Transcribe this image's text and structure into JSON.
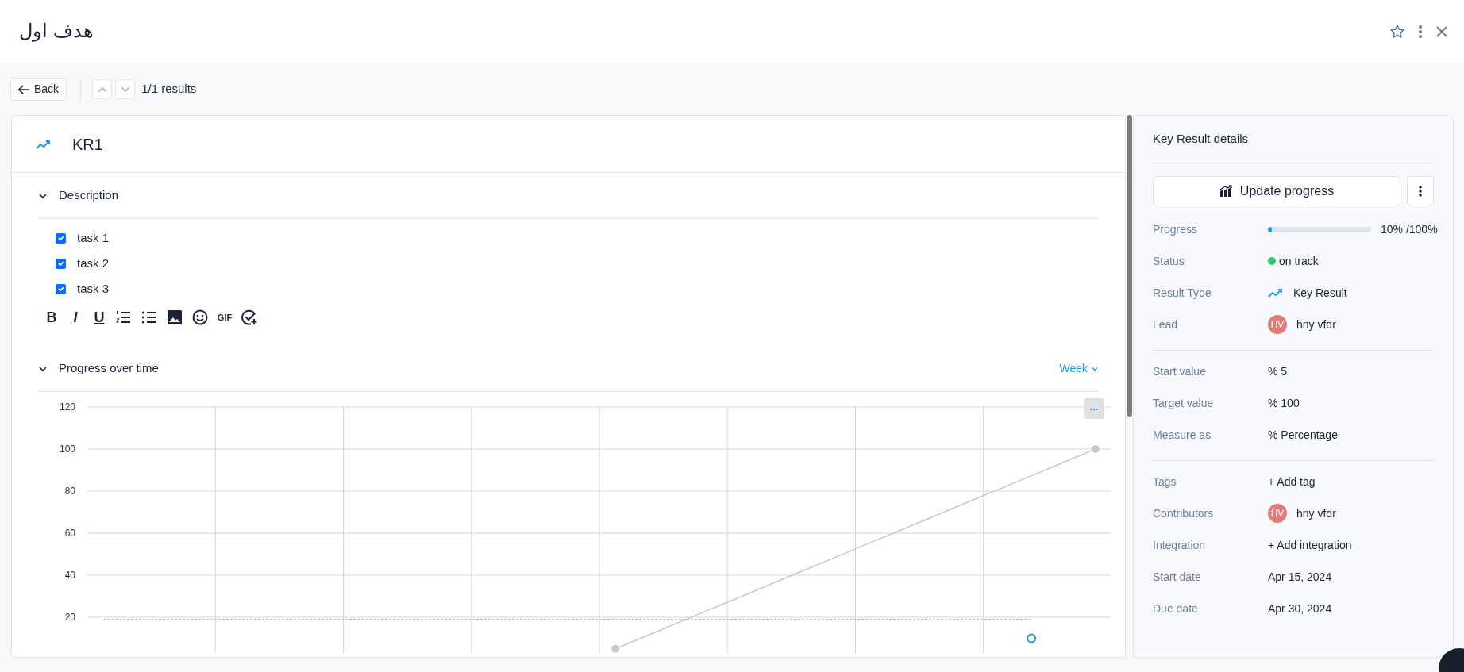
{
  "window": {
    "title": "هدف اول"
  },
  "nav": {
    "back": "Back",
    "results": "1/1 results"
  },
  "key_result": {
    "title": "KR1"
  },
  "description": {
    "heading": "Description",
    "expanded": true,
    "tasks": [
      {
        "text": "task 1",
        "checked": true
      },
      {
        "text": "task 2",
        "checked": true
      },
      {
        "text": "task 3",
        "checked": true
      }
    ],
    "editor_tools": [
      {
        "kind": "bold",
        "label": "B"
      },
      {
        "kind": "italic",
        "label": "I"
      },
      {
        "kind": "underline",
        "label": "U"
      },
      {
        "kind": "ordered-list"
      },
      {
        "kind": "bullet-list"
      },
      {
        "kind": "image"
      },
      {
        "kind": "emoji"
      },
      {
        "kind": "gif",
        "label": "GIF"
      },
      {
        "kind": "task"
      }
    ]
  },
  "progress_chart": {
    "heading": "Progress over time",
    "expanded": true,
    "period": "Week",
    "menu": "...",
    "chart_data": {
      "type": "line",
      "ylim": [
        3,
        120
      ],
      "yticks": [
        20,
        40,
        60,
        80,
        100,
        120
      ],
      "categories": [
        null,
        null,
        null,
        null,
        null,
        null,
        null,
        null,
        null,
        null,
        null,
        null,
        null,
        null,
        null,
        null,
        null,
        null,
        null,
        null,
        null,
        null,
        null,
        null,
        null,
        null,
        null,
        null,
        null,
        null,
        null,
        null
      ],
      "series": [
        {
          "color": "#c8c8cd",
          "values": [
            null,
            null,
            null,
            null,
            null,
            null,
            null,
            null,
            null,
            null,
            null,
            null,
            null,
            null,
            null,
            null,
            5,
            11.3,
            17.7,
            24,
            30.3,
            36.7,
            43,
            49.3,
            55.7,
            62,
            68.3,
            74.7,
            81,
            87.3,
            93.7,
            100
          ]
        },
        {
          "color": "#1a9be6",
          "marker": "hollow-circle",
          "values": [
            null,
            null,
            null,
            null,
            null,
            null,
            null,
            null,
            null,
            null,
            null,
            null,
            null,
            null,
            null,
            null,
            null,
            null,
            null,
            null,
            null,
            null,
            null,
            null,
            null,
            null,
            null,
            null,
            null,
            10,
            null,
            null
          ]
        },
        {
          "color": "#bbbbbb",
          "line_style": "dashed",
          "values": [
            19,
            19,
            19,
            19,
            19,
            19,
            19,
            19,
            19,
            19,
            19,
            19,
            19,
            19,
            19,
            19,
            19,
            19,
            19,
            19,
            19,
            19,
            19,
            19,
            19,
            19,
            19,
            19,
            19,
            19,
            null,
            null
          ]
        }
      ]
    }
  },
  "details": {
    "heading": "Key Result details",
    "update_button": "Update progress",
    "groups": [
      [
        {
          "kind": "progress",
          "label": "Progress",
          "level": 0.04,
          "reading": "10% /100%"
        },
        {
          "kind": "status",
          "label": "Status",
          "value": "on track",
          "color": "#2ecc71"
        },
        {
          "kind": "type",
          "label": "Result Type",
          "value": "Key Result"
        },
        {
          "kind": "person",
          "label": "Lead",
          "initials": "HV",
          "value": "hny vfdr"
        }
      ],
      [
        {
          "kind": "text",
          "label": "Start value",
          "value": "% 5"
        },
        {
          "kind": "text",
          "label": "Target value",
          "value": "% 100"
        },
        {
          "kind": "text",
          "label": "Measure as",
          "value": "%  Percentage"
        }
      ],
      [
        {
          "kind": "link",
          "label": "Tags",
          "value": "+ Add tag"
        },
        {
          "kind": "person",
          "label": "Contributors",
          "initials": "HV",
          "value": "hny vfdr"
        },
        {
          "kind": "link",
          "label": "Integration",
          "value": "+ Add integration"
        },
        {
          "kind": "text",
          "label": "Start date",
          "value": "Apr 15, 2024"
        },
        {
          "kind": "text",
          "label": "Due date",
          "value": "Apr 30, 2024"
        }
      ]
    ]
  }
}
